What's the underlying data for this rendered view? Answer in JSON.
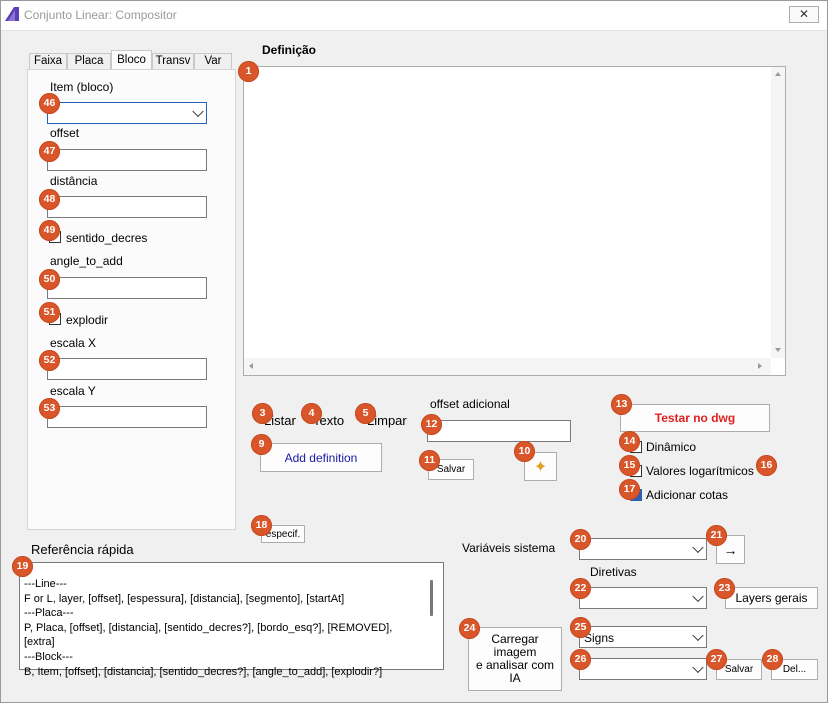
{
  "window": {
    "title": "Conjunto Linear: Compositor",
    "close_glyph": "✕"
  },
  "tabs": [
    {
      "label": "Faixa"
    },
    {
      "label": "Placa"
    },
    {
      "label": "Bloco"
    },
    {
      "label": "Transv"
    },
    {
      "label": "Var"
    }
  ],
  "bloco_panel": {
    "item_label": "Item (bloco)",
    "offset_label": "offset",
    "distancia_label": "distância",
    "sentido_label": "sentido_decres",
    "angle_label": "angle_to_add",
    "explodir_label": "explodir",
    "escala_x_label": "escala X",
    "escala_y_label": "escala Y"
  },
  "definition": {
    "heading": "Definição",
    "content": ""
  },
  "definition_toolbar": {
    "listar": "Listar",
    "texto": "Texto",
    "limpar": "Limpar",
    "add_definition": "Add definition",
    "offset_adicional_label": "offset adicional",
    "salvar": "Salvar",
    "magic_icon": "✦"
  },
  "test_panel": {
    "testar_label": "Testar no dwg",
    "dinamico_label": "Dinâmico",
    "valores_label": "Valores logarítmicos",
    "cotas_label": "Adicionar cotas",
    "cotas_checked": true
  },
  "especif_label": "especif.",
  "reference": {
    "heading": "Referência rápida",
    "text": "---Line---\nF or L, layer, [offset], [espessura], [distancia], [segmento], [startAt]\n---Placa---\nP, Placa, [offset], [distancia], [sentido_decres?], [bordo_esq?], [REMOVED], [extra]\n---Block---\nB, Item, [offset], [distancia], [sentido_decres?], [angle_to_add], [explodir?]"
  },
  "system": {
    "variaveis_label": "Variáveis sistema",
    "arrow_glyph": "→",
    "diretivas_label": "Diretivas",
    "layers_gerais_label": "Layers gerais",
    "carregar_label_1": "Carregar",
    "carregar_label_2": "imagem",
    "carregar_label_3": "e analisar com",
    "carregar_label_4": "IA",
    "signs_value": "Signs",
    "salvar_label": "Salvar",
    "del_label": "Del..."
  },
  "badges": [
    "1",
    "3",
    "4",
    "5",
    "9",
    "10",
    "11",
    "12",
    "13",
    "14",
    "15",
    "16",
    "17",
    "18",
    "19",
    "20",
    "21",
    "22",
    "23",
    "24",
    "25",
    "26",
    "27",
    "28",
    "46",
    "47",
    "48",
    "49",
    "50",
    "51",
    "52",
    "53"
  ],
  "colors": {
    "badge": "#d9562a",
    "testar_text": "#e02020",
    "add_definition_text": "#1a1aa6",
    "accent_blue": "#2b5fb3"
  }
}
